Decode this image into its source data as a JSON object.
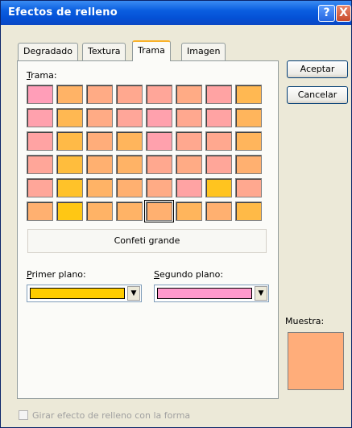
{
  "window": {
    "title": "Efectos de relleno"
  },
  "titlebar": {
    "help_glyph": "?",
    "close_glyph": "X"
  },
  "tabs": [
    {
      "label": "Degradado",
      "active": false
    },
    {
      "label": "Textura",
      "active": false
    },
    {
      "label": "Trama",
      "active": true
    },
    {
      "label": "Imagen",
      "active": false
    }
  ],
  "pattern_panel": {
    "label_first": "T",
    "label_rest": "rama:",
    "selected_pattern_name": "Confeti grande",
    "rows": 6,
    "cols": 8,
    "selected_row": 5,
    "selected_col": 4
  },
  "foreground": {
    "label_first": "P",
    "label_rest": "rimer plano:",
    "color": "#ffcc00"
  },
  "background": {
    "label_first": "S",
    "label_rest": "egundo plano:",
    "color": "#ff99cc"
  },
  "buttons": {
    "ok": "Aceptar",
    "cancel": "Cancelar"
  },
  "sample": {
    "label": "Muestra:",
    "color": "#ffad7a"
  },
  "options": {
    "rotate_with_shape": "Girar efecto de relleno con la forma"
  },
  "icons": {
    "dropdown": "chevron-down-icon"
  }
}
